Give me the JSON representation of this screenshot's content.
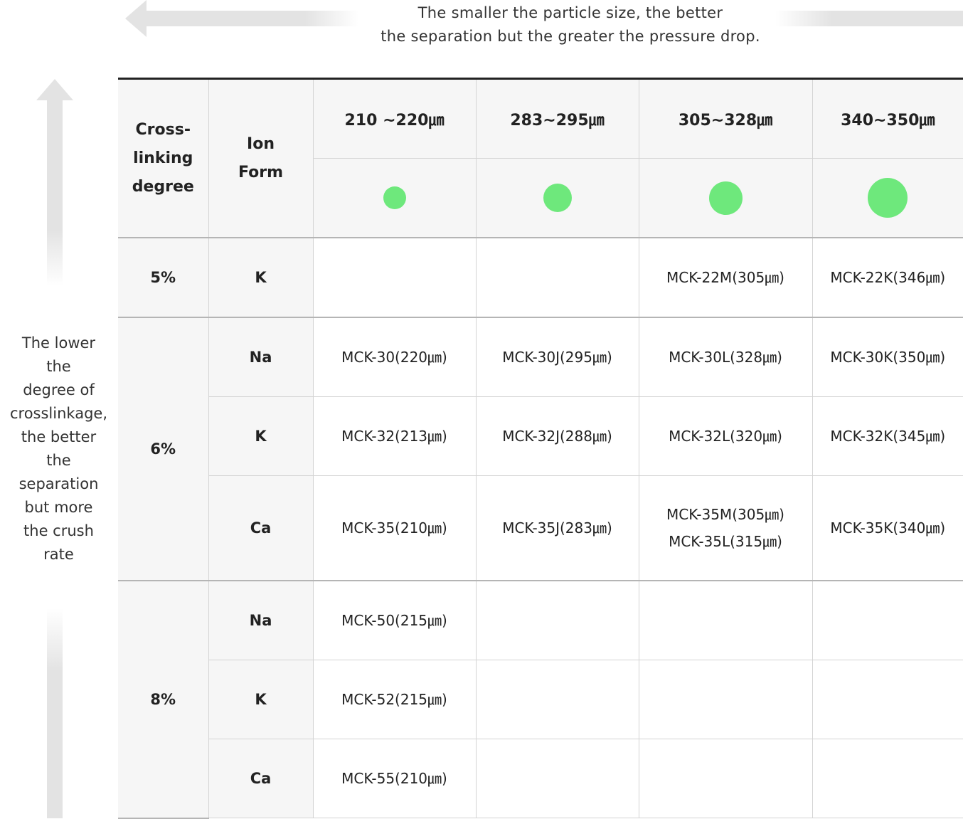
{
  "top_caption": {
    "line1": "The smaller the particle size, the better",
    "line2": "the separation but the greater the pressure drop."
  },
  "left_caption": [
    "The lower",
    "the",
    "degree of",
    "crosslinkage,",
    "the better",
    "the",
    "separation",
    "but more",
    "the crush",
    "rate"
  ],
  "headers": {
    "crosslinking": [
      "Cross-",
      "linking",
      "degree"
    ],
    "ion_form": [
      "Ion",
      "Form"
    ],
    "sizes": [
      "210 ~220㎛",
      "283~295㎛",
      "305~328㎛",
      "340~350㎛"
    ]
  },
  "dot_color": "#6ee87c",
  "dot_sizes_relative": [
    0.57,
    0.71,
    0.86,
    1.0
  ],
  "rows": {
    "r5_k": {
      "degree": "5%",
      "ion": "K",
      "c1": "",
      "c2": "",
      "c3": "MCK-22M(305㎛)",
      "c4": "MCK-22K(346㎛)"
    },
    "r6_na": {
      "degree": "6%",
      "ion": "Na",
      "c1": "MCK-30(220㎛)",
      "c2": "MCK-30J(295㎛)",
      "c3": "MCK-30L(328㎛)",
      "c4": "MCK-30K(350㎛)"
    },
    "r6_k": {
      "ion": "K",
      "c1": "MCK-32(213㎛)",
      "c2": "MCK-32J(288㎛)",
      "c3": "MCK-32L(320㎛)",
      "c4": "MCK-32K(345㎛)"
    },
    "r6_ca": {
      "ion": "Ca",
      "c1": "MCK-35(210㎛)",
      "c2": "MCK-35J(283㎛)",
      "c3a": "MCK-35M(305㎛)",
      "c3b": "MCK-35L(315㎛)",
      "c4": "MCK-35K(340㎛)"
    },
    "r8_na": {
      "degree": "8%",
      "ion": "Na",
      "c1": "MCK-50(215㎛)",
      "c2": "",
      "c3": "",
      "c4": ""
    },
    "r8_k": {
      "ion": "K",
      "c1": "MCK-52(215㎛)",
      "c2": "",
      "c3": "",
      "c4": ""
    },
    "r8_ca": {
      "ion": "Ca",
      "c1": "MCK-55(210㎛)",
      "c2": "",
      "c3": "",
      "c4": ""
    }
  }
}
